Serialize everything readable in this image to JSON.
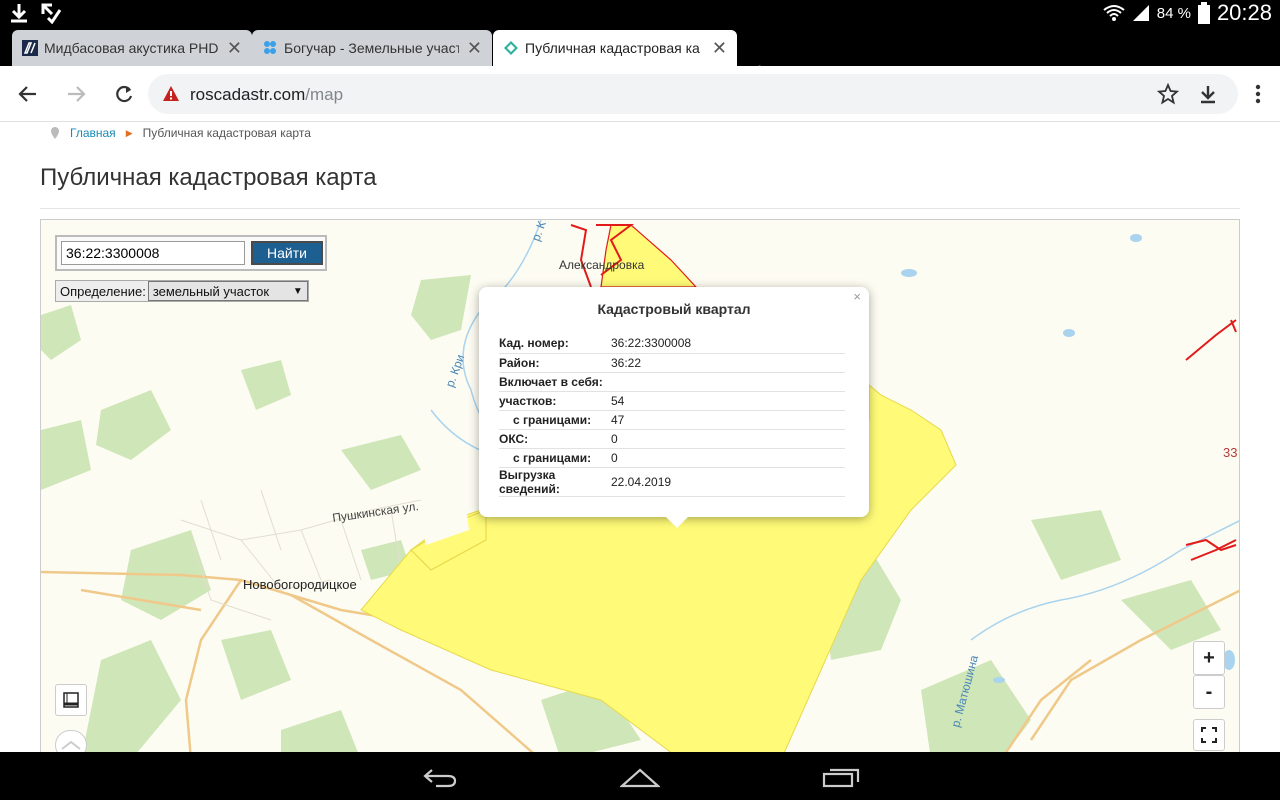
{
  "status": {
    "battery": "84 %",
    "time": "20:28"
  },
  "tabs": [
    {
      "title": "Мидбасовая акустика PHD",
      "favicon": "page-icon"
    },
    {
      "title": "Богучар - Земельные участ",
      "favicon": "dots-icon"
    },
    {
      "title": "Публичная кадастровая ка",
      "favicon": "cadastre-icon"
    }
  ],
  "omnibox": {
    "host": "roscadastr.com",
    "path": "/map"
  },
  "breadcrumb": {
    "home": "Главная",
    "current": "Публичная кадастровая карта"
  },
  "page_title": "Публичная кадастровая карта",
  "search": {
    "value": "36:22:3300008",
    "button": "Найти",
    "definition_label": "Определение:",
    "definition_value": "земельный участок"
  },
  "popup": {
    "title": "Кадастровый квартал",
    "close": "×",
    "rows": [
      {
        "key": "Кад. номер:",
        "value": "36:22:3300008",
        "sub": false
      },
      {
        "key": "Район:",
        "value": "36:22",
        "sub": false
      },
      {
        "key": "Включает в себя:",
        "value": "",
        "sub": false
      },
      {
        "key": "участков:",
        "value": "54",
        "sub": false
      },
      {
        "key": "с границами:",
        "value": "47",
        "sub": true
      },
      {
        "key": "ОКС:",
        "value": "0",
        "sub": false
      },
      {
        "key": "с границами:",
        "value": "0",
        "sub": true
      },
      {
        "key": "Выгрузка сведений:",
        "value": "22.04.2019",
        "sub": false
      }
    ]
  },
  "map_labels": {
    "village1": "Александровка",
    "village2": "Новобогородицкое",
    "street": "Пушкинская ул.",
    "river1": "р. Кри",
    "river2": "р. К",
    "river3": "р. Матюшина",
    "edge_num": "33"
  },
  "map_buttons": {
    "zoom_in": "+",
    "zoom_out": "-"
  },
  "colors": {
    "parcel_fill": "#fffb78",
    "boundary": "#e21a1a",
    "search_button": "#1d5f91"
  }
}
